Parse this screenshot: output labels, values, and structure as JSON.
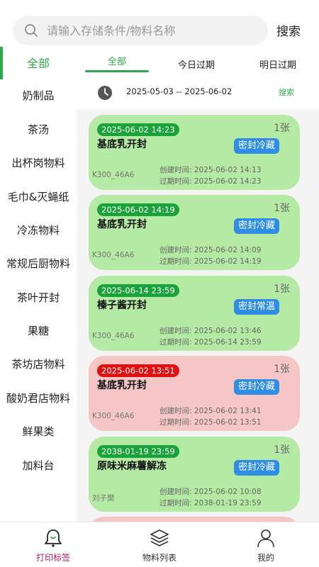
{
  "search": {
    "placeholder": "请输入存储条件/物料名称",
    "button_label": "搜索"
  },
  "sidebar": {
    "active_index": 0,
    "items": [
      {
        "label": "全部"
      },
      {
        "label": "奶制品"
      },
      {
        "label": "茶汤"
      },
      {
        "label": "出杯岗物料"
      },
      {
        "label": "毛巾&灭蝇纸"
      },
      {
        "label": "冷冻物料"
      },
      {
        "label": "常规后厨物料"
      },
      {
        "label": "茶叶开封"
      },
      {
        "label": "果糖"
      },
      {
        "label": "茶坊店物料"
      },
      {
        "label": "酸奶君店物料"
      },
      {
        "label": "鲜果类"
      },
      {
        "label": "加料台"
      }
    ]
  },
  "tabs": [
    {
      "label": "全部",
      "active": true
    },
    {
      "label": "今日过期",
      "active": false
    },
    {
      "label": "明日过期",
      "active": false
    }
  ],
  "date_filter": {
    "range": "2025-05-03 -- 2025-06-02",
    "search_label": "搜索"
  },
  "cards": [
    {
      "badge": "2025-06-02 14:23",
      "status": "green",
      "count": "1张",
      "title": "基底乳开封",
      "storage": "密封冷藏",
      "operator": "K300_46A6",
      "created": "创建时间: 2025-06-02 14:13",
      "expires": "过期时间: 2025-06-02 14:23"
    },
    {
      "badge": "2025-06-02 14:19",
      "status": "green",
      "count": "1张",
      "title": "基底乳开封",
      "storage": "密封冷藏",
      "operator": "K300_46A6",
      "created": "创建时间: 2025-06-02 14:09",
      "expires": "过期时间: 2025-06-02 14:19"
    },
    {
      "badge": "2025-06-14 23:59",
      "status": "green",
      "count": "1张",
      "title": "榛子酱开封",
      "storage": "密封常温",
      "operator": "K300_46A6",
      "created": "创建时间: 2025-06-02 13:46",
      "expires": "过期时间: 2025-06-14 23:59"
    },
    {
      "badge": "2025-06-02 13:51",
      "status": "red",
      "count": "1张",
      "title": "基底乳开封",
      "storage": "密封冷藏",
      "operator": "K300_46A6",
      "created": "创建时间: 2025-06-02 13:41",
      "expires": "过期时间: 2025-06-02 13:51"
    },
    {
      "badge": "2038-01-19 23:59",
      "status": "green",
      "count": "1张",
      "title": "原味米麻薯解冻",
      "storage": "密封冷藏",
      "operator": "刘子樊",
      "created": "创建时间: 2025-06-02 10:08",
      "expires": "过期时间: 2038-01-19 23:59"
    }
  ],
  "bottom_nav": [
    {
      "label": "打印标签",
      "icon": "bell-print-icon",
      "active": true
    },
    {
      "label": "物料列表",
      "icon": "stack-icon",
      "active": false
    },
    {
      "label": "我的",
      "icon": "user-icon",
      "active": false
    }
  ],
  "colors": {
    "accent_green": "#2ea84a",
    "card_green": "#b5eaa4",
    "card_red": "#f6c6c6",
    "badge_green": "#1aa33a",
    "badge_red": "#e01010",
    "storage_blue": "#2f8de3",
    "nav_active": "#b8185d"
  }
}
